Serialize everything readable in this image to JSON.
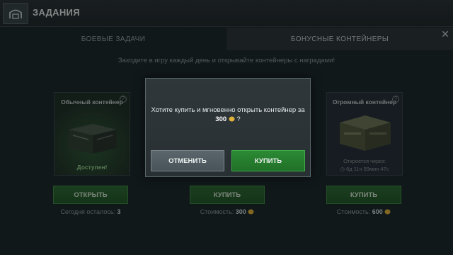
{
  "header": {
    "title": "ЗАДАНИЯ",
    "home_icon": "hangar-icon"
  },
  "tabs": [
    {
      "label": "БОЕВЫЕ ЗАДАЧИ",
      "active": false
    },
    {
      "label": "БОНУСНЫЕ КОНТЕЙНЕРЫ",
      "active": true
    }
  ],
  "close_icon": "close-icon",
  "promo_text": "Заходите в игру каждый день и открывайте контейнеры с наградами!",
  "containers": [
    {
      "title": "Обычный контейнер",
      "status": "Доступен!",
      "button": "ОТКРЫТЬ",
      "below_label": "Сегодня осталось:",
      "below_value": "3"
    },
    {
      "button": "КУПИТЬ",
      "below_label": "Стоимость:",
      "below_value": "300"
    },
    {
      "title": "Огромный контейнер",
      "status": "Откроется через:",
      "timer": "6д 11ч 59мин 47с",
      "button": "КУПИТЬ",
      "below_label": "Стоимость:",
      "below_value": "600"
    }
  ],
  "dialog": {
    "message": "Хотите купить и мгновенно открыть контейнер за",
    "price": "300",
    "question": "?",
    "cancel": "ОТМЕНИТЬ",
    "buy": "КУПИТЬ"
  },
  "colors": {
    "accent_green": "#2b8a34",
    "gold": "#e0b23a"
  }
}
